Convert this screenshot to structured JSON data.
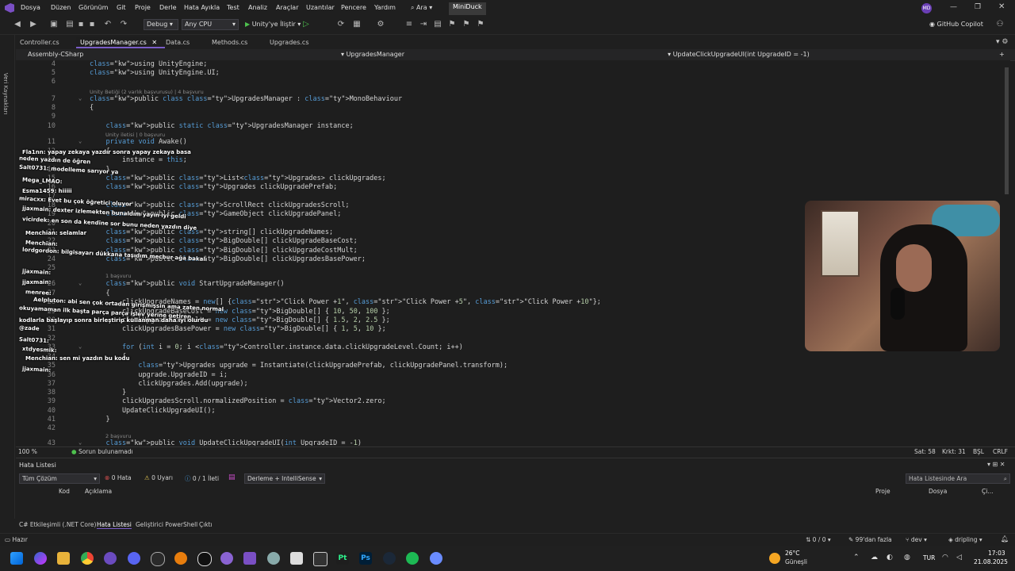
{
  "menu": [
    "Dosya",
    "Düzen",
    "Görünüm",
    "Git",
    "Proje",
    "Derle",
    "Hata Ayıkla",
    "Test",
    "Analiz",
    "Araçlar",
    "Uzantılar",
    "Pencere",
    "Yardım"
  ],
  "search_label": "Ara",
  "solution_name": "MiniDuck",
  "user_initials": "MD",
  "toolbar": {
    "config": "Debug",
    "platform": "Any CPU",
    "run_label": "Unity'ye İliştir",
    "copilot": "GitHub Copilot"
  },
  "tabs": [
    "Controller.cs",
    "UpgradesManager.cs",
    "Data.cs",
    "Methods.cs",
    "Upgrades.cs"
  ],
  "active_tab": "UpgradesManager.cs",
  "sidebar_label": "Veri Kaynakları",
  "nav": {
    "project": "Assembly-CSharp",
    "class": "UpgradesManager",
    "member": "UpdateClickUpgradeUI(int UpgradeID = -1)"
  },
  "lens": {
    "l6": "Unity Betiği (2 varlık başvurusu) | 4 başvuru",
    "l10": "Unity iletisi | 0 başvuru",
    "l28": "1 başvuru",
    "l42": "2 başvuru"
  },
  "status": {
    "zoom": "100 %",
    "issues": "Sorun bulunamadı",
    "line": "Sat: 58",
    "col": "Krkt: 31",
    "ws": "BŞL",
    "eol": "CRLF"
  },
  "errors": {
    "title": "Hata Listesi",
    "scope": "Tüm Çözüm",
    "errors": "0 Hata",
    "warnings": "0 Uyarı",
    "messages": "0 / 1 İleti",
    "filter": "Derleme + IntelliSense",
    "search_placeholder": "Hata Listesinde Ara",
    "cols": {
      "code": "Kod",
      "desc": "Açıklama",
      "project": "Proje",
      "file": "Dosya",
      "line": "Çi..."
    }
  },
  "bottom_tabs": [
    "C# Etkileşimli (.NET Core)",
    "Hata Listesi",
    "Geliştirici PowerShell",
    "Çıktı"
  ],
  "vs_status": {
    "ready": "Hazır",
    "git": "0 / 0",
    "commits": "99'dan fazla",
    "branch": "dev",
    "repo": "dripling"
  },
  "taskbar": {
    "temp": "26°C",
    "weather": "Güneşli",
    "lang": "TUR",
    "time": "17:03",
    "date": "21.08.2025"
  },
  "chat": [
    "Fla1nn: yapay zekaya yazdır sonra yapay zekaya basa",
    "neden yazdın de öğren",
    "Salt0731: modelleme sarıyor ya",
    "Mega_LMAO:",
    "Esma1459: hiiiii",
    "miracxx: Evet bu çok öğretici oluyor",
    "jjaxmain: dexter izlemekten bunaldım yayın iyi geldi",
    "vicirdek: en son da kendine sor bunu neden yazdın diye",
    "Menchian: selamlar",
    "Menchian:",
    "lordgordon: bilgisayarı dükkana taşıdım mecbur ağa bakalı",
    "jjaxmain:",
    "jjaxmain:",
    "menree:",
    "Aelpluton: abi sen çok ortadan girişmişsin ama zaten normal",
    "okuyamaman ilk başta parça parça işlev yerine getiren",
    "kodlarla başlayıp sonra birleştirip kullanman daha iyi olurdu",
    "@zade",
    "Salt0731:",
    "xtdyesmik:",
    "Menchian: sen mi yazdın bu kodu",
    "jjaxmain:"
  ],
  "code": [
    {
      "n": "4",
      "t": "using UnityEngine;"
    },
    {
      "n": "5",
      "t": "using UnityEngine.UI;"
    },
    {
      "n": "6",
      "t": ""
    },
    {
      "n": "7",
      "t": "public class UpgradesManager : MonoBehaviour"
    },
    {
      "n": "8",
      "t": "{"
    },
    {
      "n": "9",
      "t": ""
    },
    {
      "n": "10",
      "t": "    public static UpgradesManager instance;"
    },
    {
      "n": "11",
      "t": "    private void Awake()"
    },
    {
      "n": "12",
      "t": "    {"
    },
    {
      "n": "13",
      "t": "        instance = this;"
    },
    {
      "n": "14",
      "t": "    }"
    },
    {
      "n": "15",
      "t": "    public List<Upgrades> clickUpgrades;"
    },
    {
      "n": "16",
      "t": "    public Upgrades clickUpgradePrefab;"
    },
    {
      "n": "17",
      "t": ""
    },
    {
      "n": "18",
      "t": "    public ScrollRect clickUpgradesScroll;"
    },
    {
      "n": "19",
      "t": "    public GameObject clickUpgradePanel;"
    },
    {
      "n": "20",
      "t": ""
    },
    {
      "n": "21",
      "t": "    public string[] clickUpgradeNames;"
    },
    {
      "n": "22",
      "t": "    public BigDouble[] clickUpgradeBaseCost;"
    },
    {
      "n": "23",
      "t": "    public BigDouble[] clickUpgradeCostMult;"
    },
    {
      "n": "24",
      "t": "    public BigDouble[] clickUpgradesBasePower;"
    },
    {
      "n": "25",
      "t": ""
    },
    {
      "n": "26",
      "t": "    public void StartUpgradeManager()"
    },
    {
      "n": "27",
      "t": "    {"
    },
    {
      "n": "28",
      "t": "        clickUpgradeNames = new[] {\"Click Power +1\", \"Click Power +5\", \"Click Power +10\"};"
    },
    {
      "n": "29",
      "t": "        clickUpgradeBaseCost = new BigDouble[] { 10, 50, 100 };"
    },
    {
      "n": "30",
      "t": "        clickUpgradeCostMult = new BigDouble[] { 1.5, 2, 2.5 };"
    },
    {
      "n": "31",
      "t": "        clickUpgradesBasePower = new BigDouble[] { 1, 5, 10 };"
    },
    {
      "n": "32",
      "t": ""
    },
    {
      "n": "33",
      "t": "        for (int i = 0; i <Controller.instance.data.clickUpgradeLevel.Count; i++)"
    },
    {
      "n": "34",
      "t": "        {"
    },
    {
      "n": "35",
      "t": "            Upgrades upgrade = Instantiate(clickUpgradePrefab, clickUpgradePanel.transform);"
    },
    {
      "n": "36",
      "t": "            upgrade.UpgradeID = i;"
    },
    {
      "n": "37",
      "t": "            clickUpgrades.Add(upgrade);"
    },
    {
      "n": "38",
      "t": "        }"
    },
    {
      "n": "39",
      "t": "        clickUpgradesScroll.normalizedPosition = Vector2.zero;"
    },
    {
      "n": "40",
      "t": "        UpdateClickUpgradeUI();"
    },
    {
      "n": "41",
      "t": "    }"
    },
    {
      "n": "42",
      "t": ""
    },
    {
      "n": "43",
      "t": "    public void UpdateClickUpgradeUI(int UpgradeID = -1)"
    }
  ]
}
